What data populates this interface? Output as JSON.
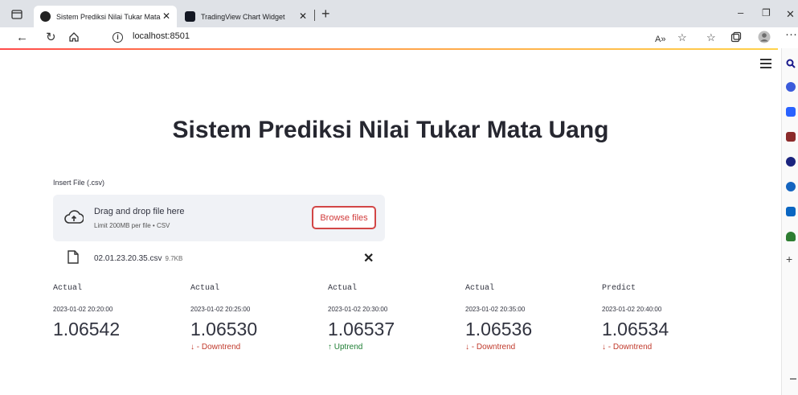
{
  "browser": {
    "tabs": [
      {
        "title": "Sistem Prediksi Nilai Tukar Mata",
        "active": true
      },
      {
        "title": "TradingView Chart Widget",
        "active": false
      }
    ],
    "url": "localhost:8501",
    "accent": "#ff4b4b"
  },
  "app": {
    "title": "Sistem Prediksi Nilai Tukar Mata Uang",
    "uploader": {
      "label": "Insert File (.csv)",
      "drop_text": "Drag and drop file here",
      "limit_text": "Limit 200MB per file • CSV",
      "browse_label": "Browse files"
    },
    "file": {
      "name": "02.01.23.20.35.csv",
      "size": "9.7KB"
    },
    "metrics": [
      {
        "label": "Actual",
        "time": "2023-01-02 20:20:00",
        "value": "1.06542",
        "delta": "",
        "trend": "none"
      },
      {
        "label": "Actual",
        "time": "2023-01-02 20:25:00",
        "value": "1.06530",
        "delta": "↓ - Downtrend",
        "trend": "down"
      },
      {
        "label": "Actual",
        "time": "2023-01-02 20:30:00",
        "value": "1.06537",
        "delta": "↑ Uptrend",
        "trend": "up"
      },
      {
        "label": "Actual",
        "time": "2023-01-02 20:35:00",
        "value": "1.06536",
        "delta": "↓ - Downtrend",
        "trend": "down"
      },
      {
        "label": "Predict",
        "time": "2023-01-02 20:40:00",
        "value": "1.06534",
        "delta": "↓ - Downtrend",
        "trend": "down"
      }
    ]
  }
}
